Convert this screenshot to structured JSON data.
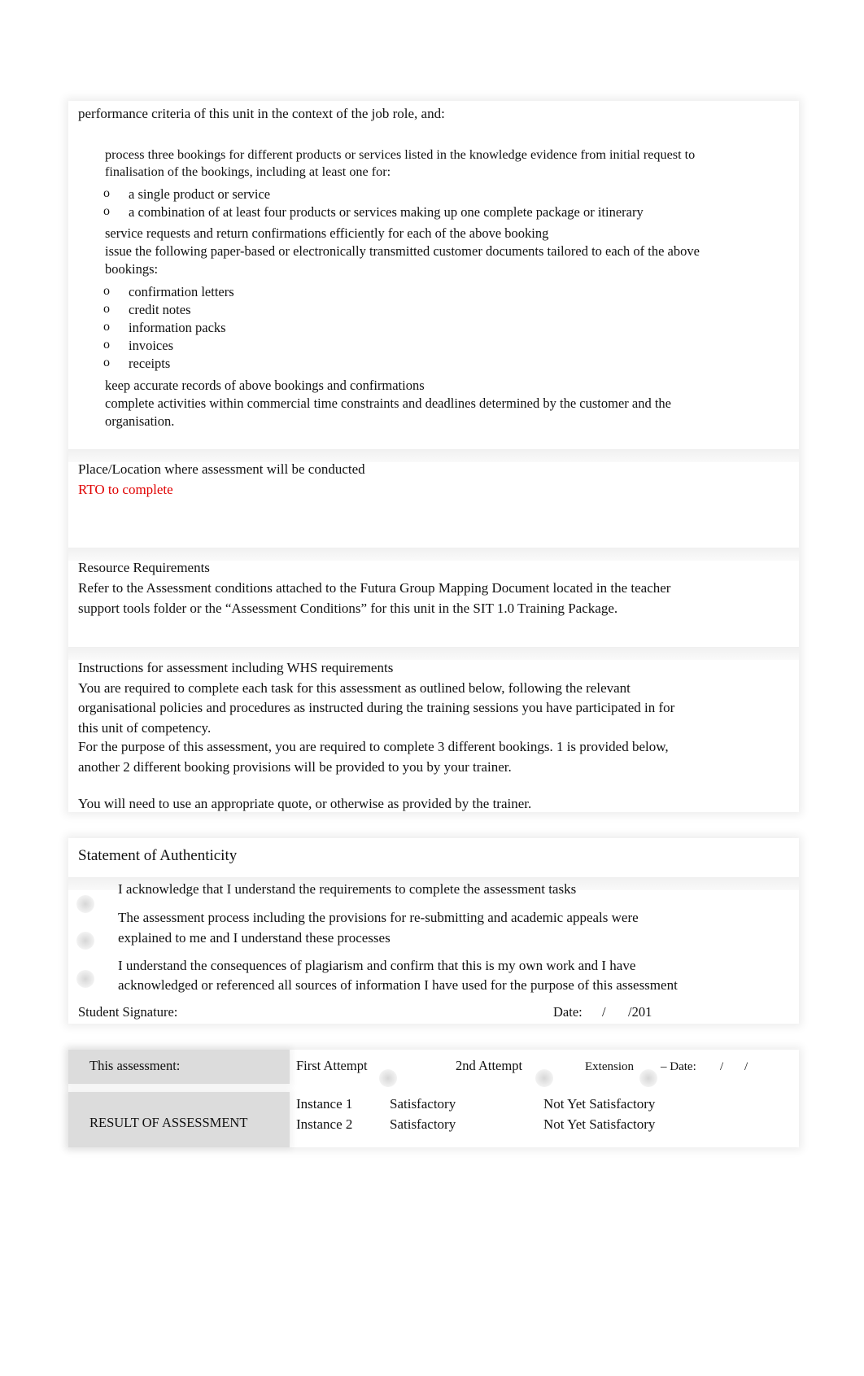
{
  "criteria": {
    "intro": "performance criteria of this unit in the context of the job role, and:",
    "bullet_glyph": "",
    "sub_glyph": "o",
    "items": [
      {
        "line1": "process three bookings for different products or services listed in the knowledge evidence from initial request to",
        "line2": "finalisation of the bookings, including at least one for:"
      },
      {
        "line1": "service requests and return confirmations efficiently for each of the above booking"
      },
      {
        "line1": "issue the following paper-based or electronically transmitted customer documents tailored to each of the above",
        "line2": "bookings:"
      },
      {
        "line1": "keep accurate records of above bookings and confirmations"
      },
      {
        "line1": "complete activities within commercial time constraints and deadlines determined by the customer and the",
        "line2": "organisation."
      }
    ],
    "sub_items_1": [
      "a single product or service",
      "a combination of at least four products or services making up one complete package or itinerary"
    ],
    "sub_items_3": [
      "confirmation letters",
      "credit notes",
      "information packs",
      "invoices",
      "receipts"
    ]
  },
  "location": {
    "heading": "Place/Location where assessment will be conducted",
    "value": "RTO to complete",
    "value_color": "#e00000"
  },
  "resources": {
    "heading": "Resource Requirements",
    "line1": "Refer to the Assessment conditions attached to the Futura Group Mapping Document located in the teacher",
    "line2": "support tools folder or the “Assessment Conditions” for this unit in the SIT 1.0 Training Package."
  },
  "instructions": {
    "heading": "Instructions for assessment including WHS requirements",
    "lines": [
      "You are required to complete each task for this assessment as outlined below, following the relevant",
      "organisational policies and procedures as instructed during the training sessions you have participated in for",
      "this unit of competency.",
      "For the purpose of this assessment, you are required to complete 3 different bookings. 1 is provided below,",
      "another 2 different booking provisions will be provided to you by your trainer.",
      "You will need to use an appropriate quote, or otherwise as provided by the trainer."
    ]
  },
  "authenticity": {
    "heading": "Statement of Authenticity",
    "statements": [
      {
        "line1": "I acknowledge that I understand the requirements to complete the assessment tasks"
      },
      {
        "line1": "The assessment process including the provisions for re-submitting and academic appeals were",
        "line2": "explained to me and I understand these processes"
      },
      {
        "line1": "I understand the consequences of plagiarism and confirm that this is my own work and I have",
        "line2": "acknowledged or referenced all sources of information I have used for the purpose of this assessment"
      }
    ],
    "signature_label": "Student Signature:",
    "date_label": "Date:",
    "date_sep": "/",
    "date_year": "/201"
  },
  "attempt": {
    "label": "This assessment:",
    "first": "First Attempt",
    "second": "2nd Attempt",
    "extension": "Extension",
    "date_label": "– Date:",
    "date_sep1": "/",
    "date_sep2": "/"
  },
  "result": {
    "label": "RESULT OF ASSESSMENT",
    "rows": [
      {
        "instance": "Instance 1",
        "sat": "Satisfactory",
        "nys": "Not Yet Satisfactory"
      },
      {
        "instance": "Instance 2",
        "sat": "Satisfactory",
        "nys": "Not Yet Satisfactory"
      }
    ]
  }
}
